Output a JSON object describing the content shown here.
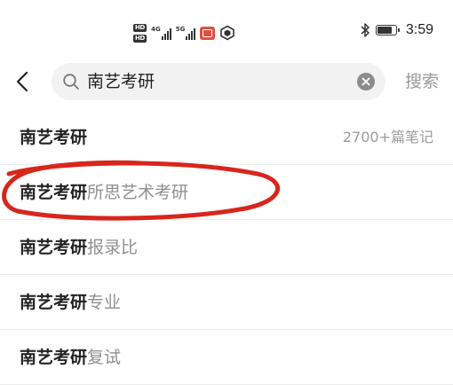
{
  "status_bar": {
    "hd_1": "HD",
    "hd_2": "HD",
    "net_1": "4G",
    "net_2": "5G",
    "time": "3:59",
    "battery_level": 0.85
  },
  "search": {
    "query": "南艺考研",
    "submit_label": "搜索"
  },
  "suggestions": [
    {
      "keyword": "南艺考研",
      "rest": "",
      "meta": "2700+篇笔记"
    },
    {
      "keyword": "南艺考研",
      "rest": "所思艺术考研",
      "meta": ""
    },
    {
      "keyword": "南艺考研",
      "rest": "报录比",
      "meta": ""
    },
    {
      "keyword": "南艺考研",
      "rest": "专业",
      "meta": ""
    },
    {
      "keyword": "南艺考研",
      "rest": "复试",
      "meta": ""
    }
  ],
  "annotation_color": "#d8261c"
}
